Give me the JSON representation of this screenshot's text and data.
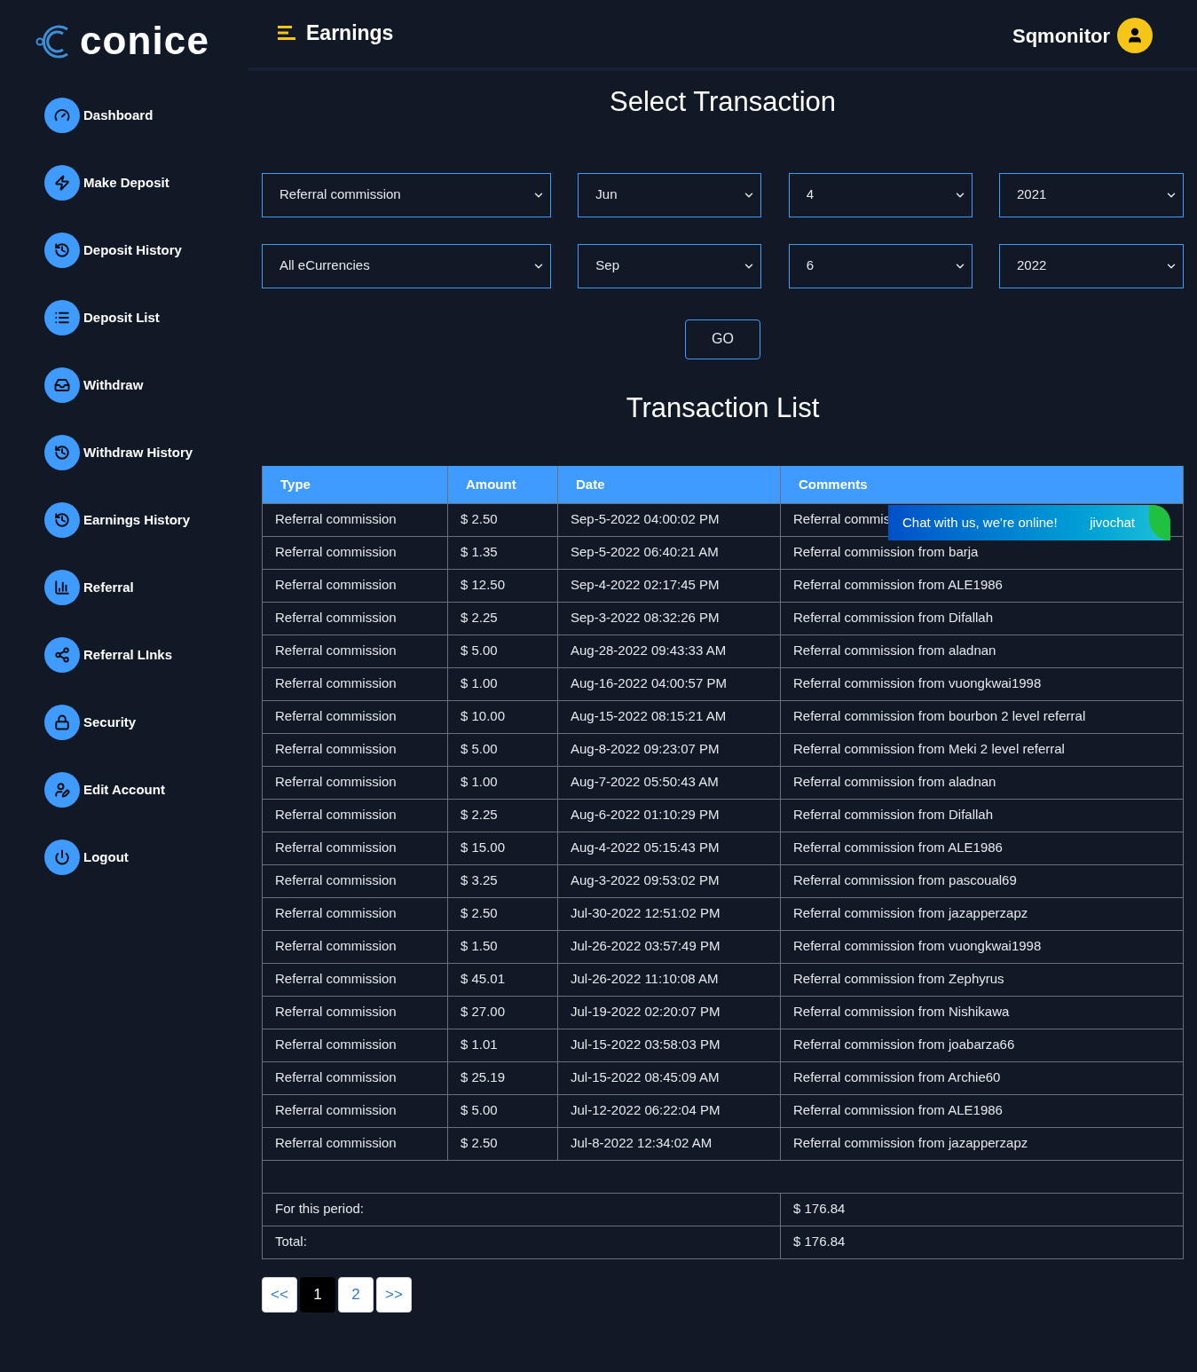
{
  "brand": {
    "logo_text": "conice"
  },
  "header": {
    "title": "Earnings",
    "user": "Sqmonitor"
  },
  "sidebar": {
    "items": [
      {
        "label": "Dashboard"
      },
      {
        "label": "Make Deposit"
      },
      {
        "label": "Deposit History"
      },
      {
        "label": "Deposit List"
      },
      {
        "label": "Withdraw"
      },
      {
        "label": "Withdraw History"
      },
      {
        "label": "Earnings History"
      },
      {
        "label": "Referral"
      },
      {
        "label": "Referral LInks"
      },
      {
        "label": "Security"
      },
      {
        "label": "Edit Account"
      },
      {
        "label": "Logout"
      }
    ]
  },
  "filter": {
    "title": "Select Transaction",
    "rows": [
      [
        "Referral commission",
        "Jun",
        "4",
        "2021"
      ],
      [
        "All eCurrencies",
        "Sep",
        "6",
        "2022"
      ]
    ],
    "button": "GO"
  },
  "table": {
    "title": "Transaction List",
    "columns": [
      "Type",
      "Amount",
      "Date",
      "Comments"
    ],
    "rows": [
      [
        "Referral commission",
        "$ 2.50",
        "Sep-5-2022 04:00:02 PM",
        "Referral commis"
      ],
      [
        "Referral commission",
        "$ 1.35",
        "Sep-5-2022 06:40:21 AM",
        "Referral commission from barja"
      ],
      [
        "Referral commission",
        "$ 12.50",
        "Sep-4-2022 02:17:45 PM",
        "Referral commission from ALE1986"
      ],
      [
        "Referral commission",
        "$ 2.25",
        "Sep-3-2022 08:32:26 PM",
        "Referral commission from Difallah"
      ],
      [
        "Referral commission",
        "$ 5.00",
        "Aug-28-2022 09:43:33 AM",
        "Referral commission from aladnan"
      ],
      [
        "Referral commission",
        "$ 1.00",
        "Aug-16-2022 04:00:57 PM",
        "Referral commission from vuongkwai1998"
      ],
      [
        "Referral commission",
        "$ 10.00",
        "Aug-15-2022 08:15:21 AM",
        "Referral commission from bourbon 2 level referral"
      ],
      [
        "Referral commission",
        "$ 5.00",
        "Aug-8-2022 09:23:07 PM",
        "Referral commission from Meki 2 level referral"
      ],
      [
        "Referral commission",
        "$ 1.00",
        "Aug-7-2022 05:50:43 AM",
        "Referral commission from aladnan"
      ],
      [
        "Referral commission",
        "$ 2.25",
        "Aug-6-2022 01:10:29 PM",
        "Referral commission from Difallah"
      ],
      [
        "Referral commission",
        "$ 15.00",
        "Aug-4-2022 05:15:43 PM",
        "Referral commission from ALE1986"
      ],
      [
        "Referral commission",
        "$ 3.25",
        "Aug-3-2022 09:53:02 PM",
        "Referral commission from pascoual69"
      ],
      [
        "Referral commission",
        "$ 2.50",
        "Jul-30-2022 12:51:02 PM",
        "Referral commission from jazapperzapz"
      ],
      [
        "Referral commission",
        "$ 1.50",
        "Jul-26-2022 03:57:49 PM",
        "Referral commission from vuongkwai1998"
      ],
      [
        "Referral commission",
        "$ 45.01",
        "Jul-26-2022 11:10:08 AM",
        "Referral commission from Zephyrus"
      ],
      [
        "Referral commission",
        "$ 27.00",
        "Jul-19-2022 02:20:07 PM",
        "Referral commission from Nishikawa"
      ],
      [
        "Referral commission",
        "$ 1.01",
        "Jul-15-2022 03:58:03 PM",
        "Referral commission from joabarza66"
      ],
      [
        "Referral commission",
        "$ 25.19",
        "Jul-15-2022 08:45:09 AM",
        "Referral commission from Archie60"
      ],
      [
        "Referral commission",
        "$ 5.00",
        "Jul-12-2022 06:22:04 PM",
        "Referral commission from ALE1986"
      ],
      [
        "Referral commission",
        "$ 2.50",
        "Jul-8-2022 12:34:02 AM",
        "Referral commission from jazapperzapz"
      ]
    ],
    "summary": [
      {
        "label": "For this period:",
        "value": "$ 176.84"
      },
      {
        "label": "Total:",
        "value": "$ 176.84"
      }
    ]
  },
  "pagination": [
    {
      "label": "<<",
      "selected": false
    },
    {
      "label": "1",
      "selected": true
    },
    {
      "label": "2",
      "selected": false
    },
    {
      "label": ">>",
      "selected": false
    }
  ],
  "chat": {
    "message": "Chat with us, we're online!",
    "brand": "jivochat"
  }
}
